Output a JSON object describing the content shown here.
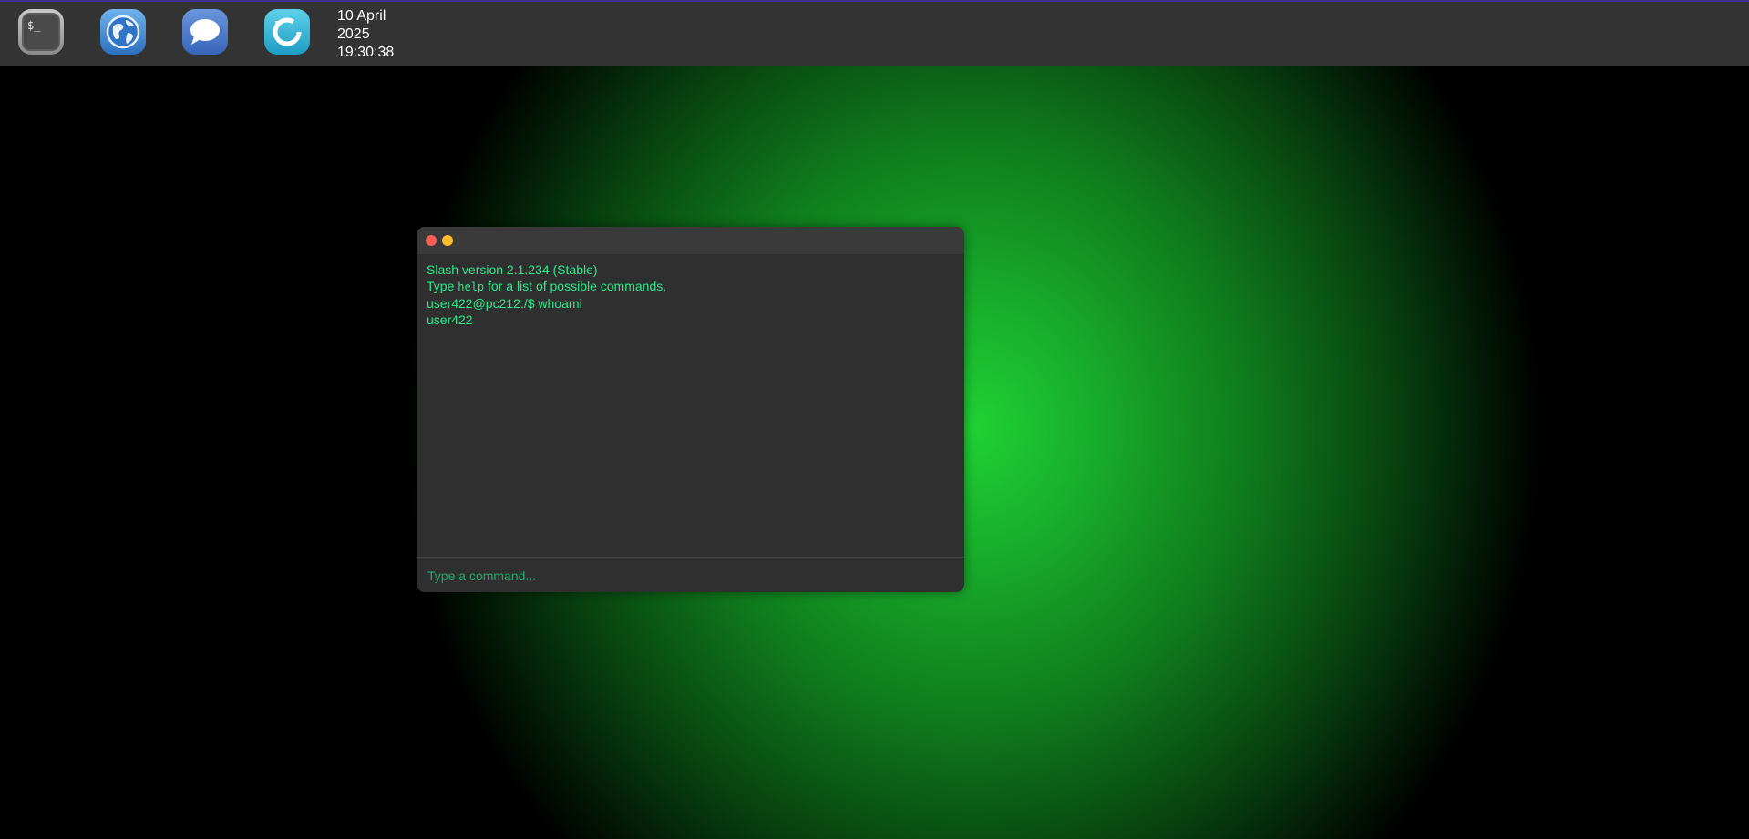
{
  "taskbar": {
    "apps": [
      {
        "name": "terminal",
        "icon": "terminal-icon",
        "glyph": "$_"
      },
      {
        "name": "browser",
        "icon": "globe-icon"
      },
      {
        "name": "chat",
        "icon": "chat-bubble-icon"
      },
      {
        "name": "update",
        "icon": "refresh-icon"
      }
    ],
    "clock": {
      "date_line1": "10 April",
      "date_line2": "2025",
      "time": "19:30:38"
    }
  },
  "terminal": {
    "output": {
      "version_line": "Slash version 2.1.234 (Stable)",
      "help_prefix": "Type ",
      "help_command": "help",
      "help_suffix": " for a list of possible commands.",
      "prompt_line": "user422@pc212:/$ whoami",
      "result_line": "user422"
    },
    "input": {
      "value": "",
      "placeholder": "Type a command..."
    }
  },
  "colors": {
    "accent_green": "#2ee88a",
    "desktop_glow": "#1ed234",
    "close_button": "#ff5f56",
    "minimize_button": "#ffbd2e"
  }
}
